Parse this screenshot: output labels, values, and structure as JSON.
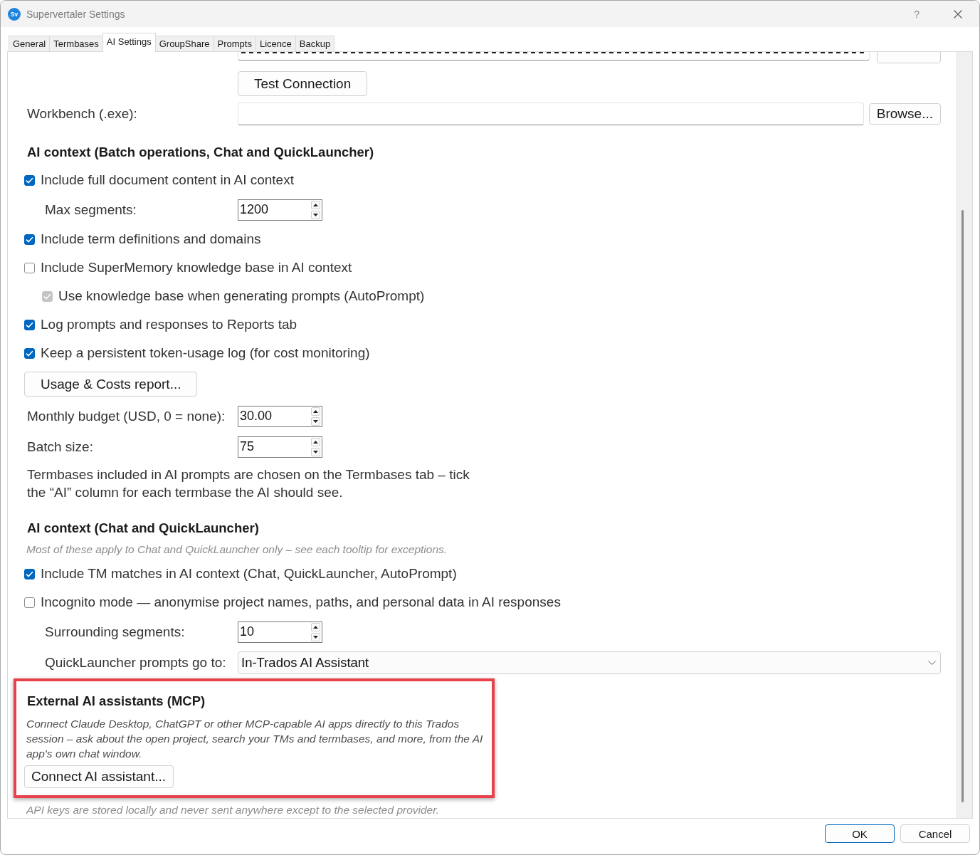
{
  "window": {
    "logo": "Sv",
    "title": "Supervertaler Settings",
    "help": "?"
  },
  "tabs": [
    {
      "label": "General",
      "selected": false
    },
    {
      "label": "Termbases",
      "selected": false
    },
    {
      "label": "AI Settings",
      "selected": true
    },
    {
      "label": "GroupShare",
      "selected": false
    },
    {
      "label": "Prompts",
      "selected": false
    },
    {
      "label": "Licence",
      "selected": false
    },
    {
      "label": "Backup",
      "selected": false
    }
  ],
  "content": [
    {
      "kind": "secret"
    },
    {
      "kind": "action",
      "button": "Test Connection"
    },
    {
      "kind": "file",
      "label": "Workbench (.exe):",
      "button": "Browse..."
    },
    {
      "kind": "heading",
      "text": "AI context (Batch operations, Chat and QuickLauncher)"
    },
    {
      "kind": "checkbox",
      "label": "Include full document content in AI context",
      "checked": true,
      "disabled": false,
      "children": [
        {
          "kind": "spinner",
          "label": "Max segments:",
          "value": "1200"
        }
      ]
    },
    {
      "kind": "checkbox",
      "label": "Include term definitions and domains",
      "checked": true,
      "disabled": false
    },
    {
      "kind": "checkbox",
      "label": "Include SuperMemory knowledge base in AI context",
      "checked": false,
      "disabled": false,
      "children": [
        {
          "kind": "checkbox",
          "label": "Use knowledge base when generating prompts (AutoPrompt)",
          "checked": true,
          "disabled": true
        }
      ]
    },
    {
      "kind": "checkbox",
      "label": "Log prompts and responses to Reports tab",
      "checked": true,
      "disabled": false
    },
    {
      "kind": "checkbox",
      "label": "Keep a persistent token-usage log (for cost monitoring)",
      "checked": true,
      "disabled": false
    },
    {
      "kind": "button",
      "text": "Usage & Costs report..."
    },
    {
      "kind": "spinner",
      "label": "Monthly budget (USD, 0 = none):",
      "value": "30.00"
    },
    {
      "kind": "spinner",
      "label": "Batch size:",
      "value": "75"
    },
    {
      "kind": "paragraph",
      "text": "Termbases included in AI prompts are chosen on the Termbases tab – tick the “AI” column for each termbase the AI should see."
    },
    {
      "kind": "heading",
      "text": "AI context (Chat and QuickLauncher)"
    },
    {
      "kind": "hint",
      "text": "Most of these apply to Chat and QuickLauncher only – see each tooltip for exceptions."
    },
    {
      "kind": "checkbox",
      "label": "Include TM matches in AI context (Chat, QuickLauncher, AutoPrompt)",
      "checked": true,
      "disabled": false
    },
    {
      "kind": "checkbox",
      "label": "Incognito mode — anonymise project names, paths, and personal data in AI responses",
      "checked": false,
      "disabled": false
    },
    {
      "kind": "group",
      "children": [
        {
          "kind": "spinner",
          "label": "Surrounding segments:",
          "value": "10"
        },
        {
          "kind": "combo",
          "label": "QuickLauncher prompts go to:",
          "value": "In-Trados AI Assistant"
        }
      ]
    },
    {
      "kind": "highlight",
      "children": [
        {
          "kind": "heading",
          "text": "External AI assistants (MCP)"
        },
        {
          "kind": "note",
          "text": "Connect Claude Desktop, ChatGPT or other MCP-capable AI apps directly to this Trados session – ask about the open project, search your TMs and termbases, and more, from the AI app's own chat window."
        },
        {
          "kind": "button",
          "text": "Connect AI assistant..."
        }
      ]
    },
    {
      "kind": "hint",
      "text": "API keys are stored locally and never sent anywhere except to the selected provider."
    }
  ],
  "buttons": [
    {
      "label": "OK",
      "default": true
    },
    {
      "label": "Cancel",
      "default": false
    }
  ]
}
